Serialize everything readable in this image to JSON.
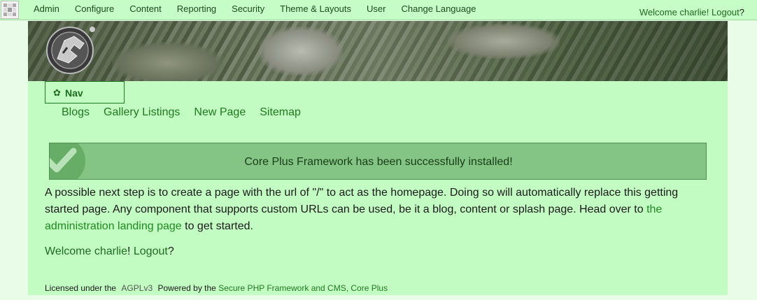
{
  "admin_bar": {
    "menu": [
      "Admin",
      "Configure",
      "Content",
      "Reporting",
      "Security",
      "Theme & Layouts",
      "User",
      "Change Language"
    ],
    "welcome_prefix": "Welcome ",
    "username": "charlie",
    "welcome_sep": "! ",
    "logout": "Logout",
    "question": "?"
  },
  "nav": {
    "title": "Nav",
    "links": [
      "Blogs",
      "Gallery Listings",
      "New Page",
      "Sitemap"
    ]
  },
  "message": {
    "text": "Core Plus Framework has been successfully installed!",
    "color": "#84c484"
  },
  "intro": {
    "text_before": "A possible next step is to create a page with the url of \"/\" to act as the homepage. Doing so will automatically replace this getting started page. Any component that supports custom URLs can be used, be it a blog, content or splash page. Head over to ",
    "link": "the administration landing page",
    "text_after": " to get started."
  },
  "welcome": {
    "prefix": "Welcome ",
    "username": "charlie",
    "sep": "! ",
    "logout": "Logout",
    "question": "?"
  },
  "footer": {
    "licensed": "Licensed under the",
    "license": "AGPLv3",
    "powered": "Powered by the",
    "link": "Secure PHP Framework and CMS, Core Plus"
  },
  "colors": {
    "page_bg": "#c3fcc3",
    "body_bg": "#e8fce8",
    "link": "#1f7a1f"
  }
}
